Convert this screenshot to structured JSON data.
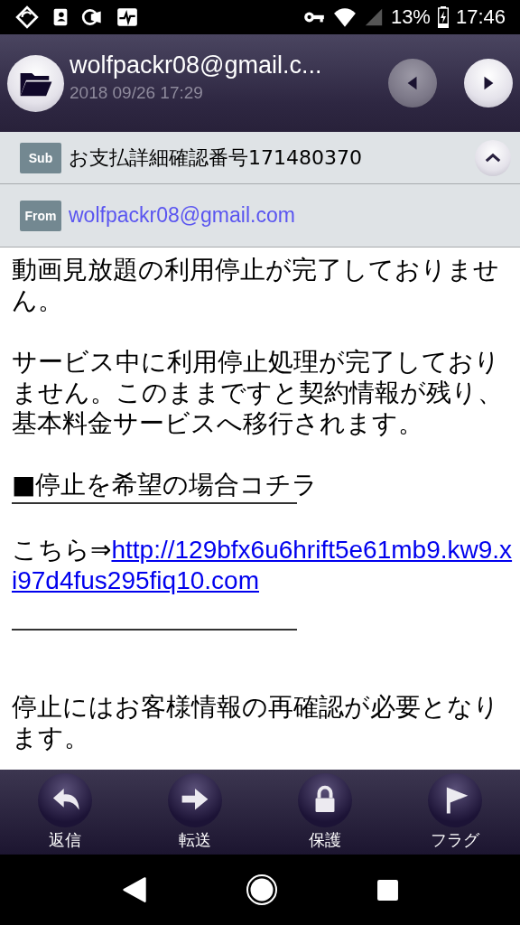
{
  "status_bar": {
    "battery": "13%",
    "time": "17:46"
  },
  "header": {
    "title": "wolfpackr08@gmail.c...",
    "date": "2018 09/26 17:29"
  },
  "subject": {
    "label": "Sub",
    "text": "お支払詳細確認番号171480370"
  },
  "from": {
    "label": "From",
    "address": "wolfpackr08@gmail.com"
  },
  "body": [
    {
      "kind": "text",
      "text": "動画見放題の利用停止が完了しておりません。"
    },
    {
      "kind": "blank"
    },
    {
      "kind": "text",
      "text": "サービス中に利用停止処理が完了しておりません。このままですと契約情報が残り、基本料金サービスへ移行されます。"
    },
    {
      "kind": "blank"
    },
    {
      "kind": "heading",
      "text": "■停止を希望の場合コチラ"
    },
    {
      "kind": "blank"
    },
    {
      "kind": "link",
      "prefix": "こちら⇒",
      "url": "http://129bfx6u6hrift5e61mb9.kw9.xi97d4fus295fiq10.com"
    },
    {
      "kind": "blank"
    },
    {
      "kind": "rule"
    },
    {
      "kind": "blank"
    },
    {
      "kind": "blank"
    },
    {
      "kind": "text",
      "text": "停止にはお客様情報の再確認が必要となります。"
    }
  ],
  "toolbar": [
    {
      "kind": "reply",
      "label": "返信"
    },
    {
      "kind": "forward",
      "label": "転送"
    },
    {
      "kind": "lock",
      "label": "保護"
    },
    {
      "kind": "flag",
      "label": "フラグ"
    }
  ]
}
